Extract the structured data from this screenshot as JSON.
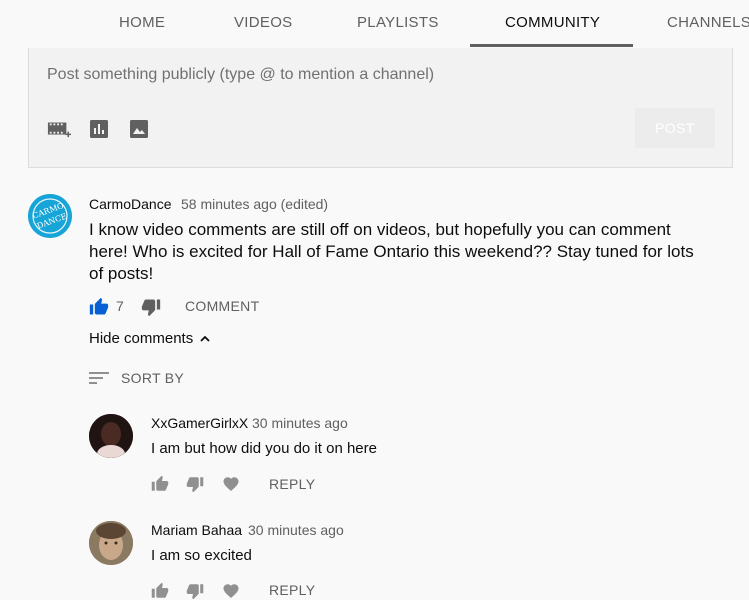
{
  "tabs": [
    {
      "label": "HOME"
    },
    {
      "label": "VIDEOS"
    },
    {
      "label": "PLAYLISTS"
    },
    {
      "label": "COMMUNITY",
      "active": true
    },
    {
      "label": "CHANNELS"
    }
  ],
  "composer": {
    "placeholder": "Post something publicly (type @ to mention a channel)",
    "tools": [
      "video-add-icon",
      "poll-icon",
      "image-icon"
    ],
    "post_label": "POST"
  },
  "post": {
    "author": "CarmoDance",
    "time": "58 minutes ago (edited)",
    "text": "I know video comments are still off on videos, but hopefully you can comment here! Who is excited for Hall of Fame Ontario this weekend?? Stay tuned for lots of posts!",
    "likes": "7",
    "comment_label": "COMMENT",
    "avatar_text": "CARMO DANCE",
    "hide_comments_label": "Hide comments",
    "sort_label": "SORT BY"
  },
  "replies": [
    {
      "author": "XxGamerGirlxX",
      "time": "30 minutes ago",
      "text": "I am but how did you do it on here",
      "reply_label": "REPLY"
    },
    {
      "author": "Mariam Bahaa",
      "time": "30 minutes ago",
      "text": "I am so excited",
      "reply_label": "REPLY"
    }
  ],
  "colors": {
    "like_active": "#065fd4",
    "icon_gray": "#606060",
    "avatar_main": "#17a4d6"
  }
}
